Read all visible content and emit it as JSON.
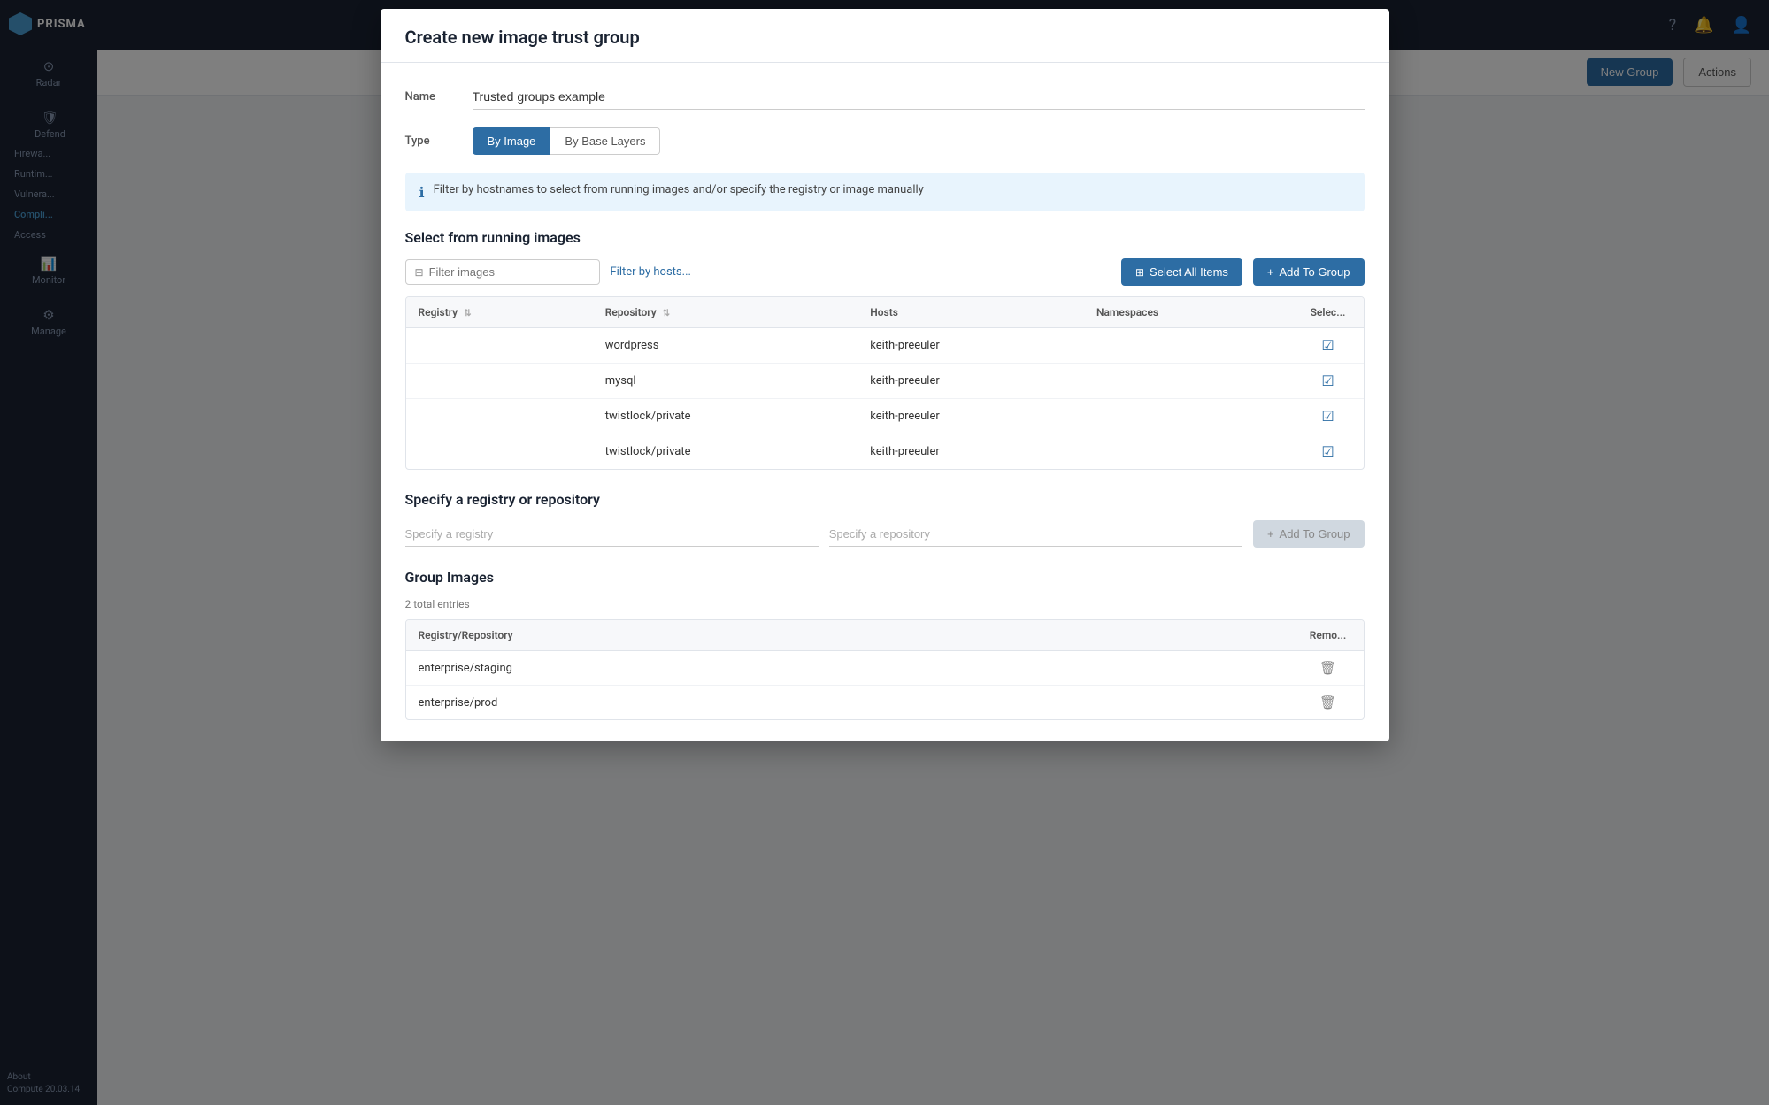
{
  "app": {
    "name": "PRISMA",
    "version": "Compute 20.03.14"
  },
  "sidebar": {
    "logo": "PRISMA",
    "items": [
      {
        "id": "radar",
        "label": "Radar",
        "icon": "⊙"
      },
      {
        "id": "defend",
        "label": "Defend",
        "icon": "🛡"
      },
      {
        "id": "monitor",
        "label": "Monitor",
        "icon": "📊"
      },
      {
        "id": "manage",
        "label": "Manage",
        "icon": "⚙"
      }
    ],
    "defend_subitems": [
      {
        "id": "firewall",
        "label": "Firewa..."
      },
      {
        "id": "runtime",
        "label": "Runtim..."
      },
      {
        "id": "vulnerabilities",
        "label": "Vulnera..."
      },
      {
        "id": "compliance",
        "label": "Compli...",
        "active": true
      },
      {
        "id": "access",
        "label": "Access"
      }
    ],
    "about": "About",
    "compute_version": "Compute 20.03.14"
  },
  "topbar": {
    "icons": [
      "?",
      "🔔",
      "👤"
    ]
  },
  "toolbar": {
    "new_group_label": "New Group",
    "actions_label": "Actions"
  },
  "tabs": {
    "type_by_image": "By Image",
    "type_by_base_layers": "By Base Layers"
  },
  "modal": {
    "title": "Create new image trust group",
    "name_label": "Name",
    "name_value": "Trusted groups example",
    "type_label": "Type",
    "type_options": [
      "By Image",
      "By Base Layers"
    ],
    "type_selected": "By Image",
    "info_text": "Filter by hostnames to select from running images and/or specify the registry or image manually",
    "running_images_section_title": "Select from running images",
    "filter_placeholder": "Filter images",
    "filter_by_hosts_link": "Filter by hosts...",
    "select_all_btn": "Select All Items",
    "add_to_group_btn": "Add To Group",
    "table": {
      "columns": [
        {
          "id": "registry",
          "label": "Registry"
        },
        {
          "id": "repository",
          "label": "Repository"
        },
        {
          "id": "hosts",
          "label": "Hosts"
        },
        {
          "id": "namespaces",
          "label": "Namespaces"
        },
        {
          "id": "select",
          "label": "Selec..."
        }
      ],
      "rows": [
        {
          "registry": "",
          "repository": "wordpress",
          "hosts": "keith-preeuler",
          "namespaces": "",
          "selected": true
        },
        {
          "registry": "",
          "repository": "mysql",
          "hosts": "keith-preeuler",
          "namespaces": "",
          "selected": true
        },
        {
          "registry": "",
          "repository": "twistlock/private",
          "hosts": "keith-preeuler",
          "namespaces": "",
          "selected": true
        },
        {
          "registry": "",
          "repository": "twistlock/private",
          "hosts": "keith-preeuler",
          "namespaces": "",
          "selected": true
        }
      ]
    },
    "specify_section_title": "Specify a registry or repository",
    "specify_registry_placeholder": "Specify a registry",
    "specify_repository_placeholder": "Specify a repository",
    "specify_add_btn": "Add To Group",
    "group_images_section_title": "Group Images",
    "group_entries_count": "2 total entries",
    "group_table": {
      "columns": [
        {
          "id": "registry_repo",
          "label": "Registry/Repository"
        },
        {
          "id": "remove",
          "label": "Remo..."
        }
      ],
      "rows": [
        {
          "registry_repo": "enterprise/staging"
        },
        {
          "registry_repo": "enterprise/prod"
        }
      ]
    }
  },
  "colors": {
    "primary": "#2d6da4",
    "sidebar_bg": "#1a2332",
    "active_nav": "#4a9fd4",
    "border": "#e0e4ea",
    "bg_light": "#f7f8fa"
  }
}
